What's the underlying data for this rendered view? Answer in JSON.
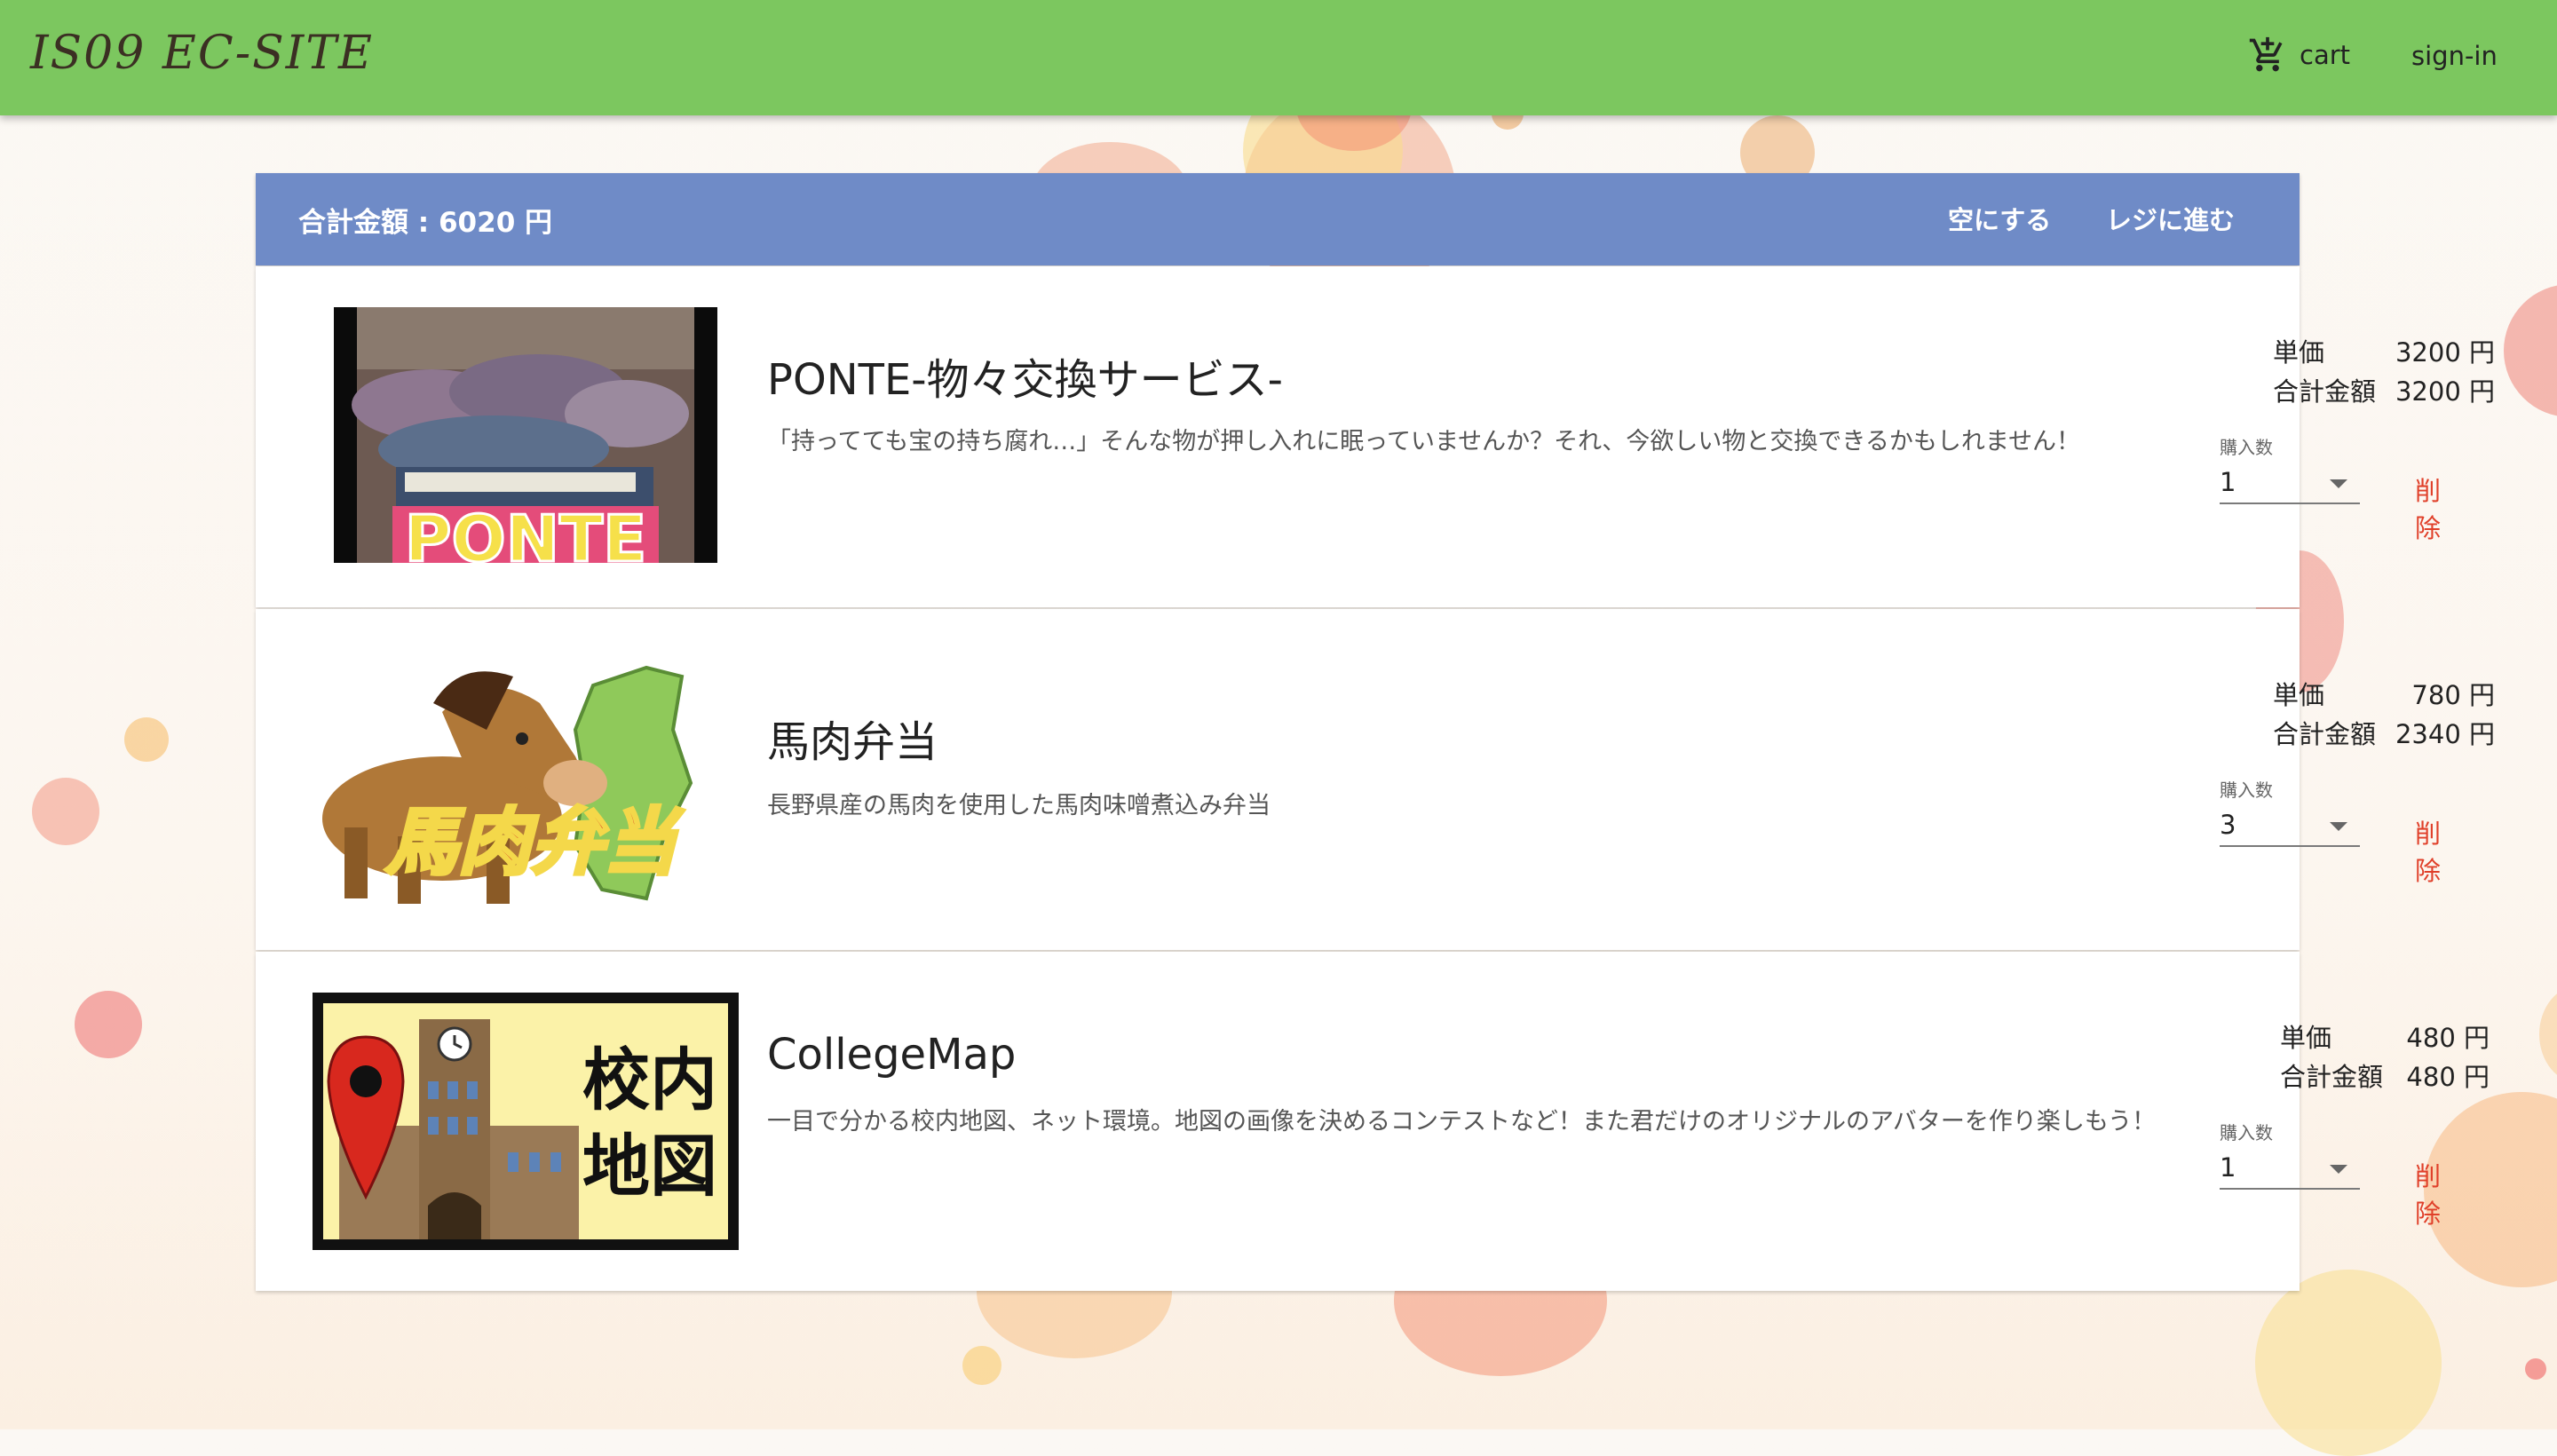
{
  "app": {
    "title": "IS09 EC-SITE"
  },
  "nav": {
    "cart_label": "cart",
    "signin_label": "sign-in"
  },
  "cart": {
    "total_text": "合計金額 : 6020 円",
    "clear_label": "空にする",
    "checkout_label": "レジに進む"
  },
  "items": [
    {
      "name": "PONTE-物々交換サービス-",
      "description": "「持ってても宝の持ち腐れ…」そんな物が押し入れに眠っていませんか？それ、今欲しい物と交換できるかもしれません！",
      "unit_price_label": "単価",
      "unit_price": "3200 円",
      "subtotal_label": "合計金額",
      "subtotal": "3200 円",
      "qty_label": "購入数",
      "qty": "1",
      "delete_label": "削除",
      "thumb_text": "PONTE"
    },
    {
      "name": "馬肉弁当",
      "description": "長野県産の馬肉を使用した馬肉味噌煮込み弁当",
      "unit_price_label": "単価",
      "unit_price": "780 円",
      "subtotal_label": "合計金額",
      "subtotal": "2340 円",
      "qty_label": "購入数",
      "qty": "3",
      "delete_label": "削除",
      "thumb_text": "馬肉弁当"
    },
    {
      "name": "CollegeMap",
      "description": "一目で分かる校内地図、ネット環境。地図の画像を決めるコンテストなど！また君だけのオリジナルのアバターを作り楽しもう！",
      "unit_price_label": "単価",
      "unit_price": "480 円",
      "subtotal_label": "合計金額",
      "subtotal": "480 円",
      "qty_label": "購入数",
      "qty": "1",
      "delete_label": "削除",
      "thumb_text_1": "校内",
      "thumb_text_2": "地図"
    }
  ],
  "colors": {
    "topbar": "#7cc75f",
    "cart_header": "#6f8bc7",
    "delete": "#e0402a"
  }
}
